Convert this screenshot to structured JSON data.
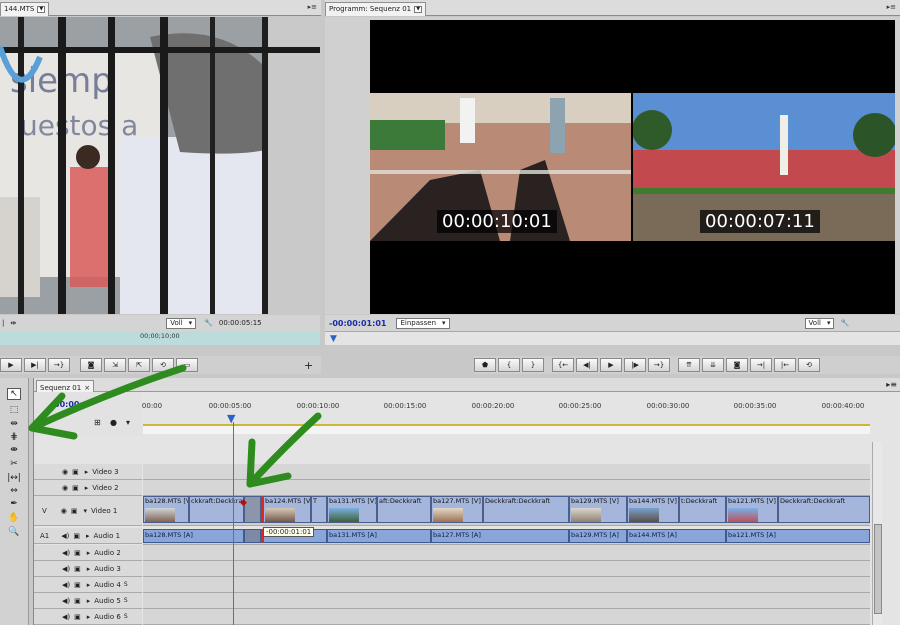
{
  "source_monitor": {
    "tab_label": "144.MTS",
    "menu": "▸≡",
    "zoom_value": "Voll",
    "timecode": "00:00:05:15",
    "mini_ruler_label": "00;00;10;00"
  },
  "program_monitor": {
    "tab_label": "Programm: Sequenz 01",
    "menu": "▸≡",
    "overlay_left_tc": "00:00:10:01",
    "overlay_right_tc": "00:00:07:11",
    "current_tc": "-00:00:01:01",
    "fit_value": "Einpassen",
    "zoom_value": "Voll"
  },
  "timeline": {
    "tab_label": "Sequenz 01",
    "playhead_tc": "00:00:0",
    "ruler": [
      "00:00",
      "00:00:05:00",
      "00:00:10:00",
      "00:00:15:00",
      "00:00:20:00",
      "00:00:25:00",
      "00:00:30:00",
      "00:00:35:00",
      "00:00:40:00"
    ],
    "tracks_video": [
      "Video 3",
      "Video 2",
      "Video 1"
    ],
    "tracks_audio": [
      "Audio 1",
      "Audio 2",
      "Audio 3",
      "Audio 4",
      "Audio 5",
      "Audio 6"
    ],
    "audio_suffix": "S",
    "v_target": "V",
    "a_target": "A1",
    "tooltip": "-00:00:01:01",
    "video_clips": [
      {
        "label": "ba128.MTS [V]"
      },
      {
        "label": "ckkraft:Deckkraft"
      },
      {
        "label": "ba124.MTS [V]"
      },
      {
        "label": "T"
      },
      {
        "label": "ba131.MTS [V]"
      },
      {
        "label": "aft:Deckkraft"
      },
      {
        "label": "ba127.MTS [V]"
      },
      {
        "label": "Deckkraft:Deckkraft"
      },
      {
        "label": "ba129.MTS [V]"
      },
      {
        "label": "ba144.MTS [V]"
      },
      {
        "label": "t:Deckkraft"
      },
      {
        "label": "ba121.MTS [V]"
      },
      {
        "label": "Deckkraft:Deckkraft"
      }
    ],
    "audio_clips": [
      {
        "label": "ba128.MTS [A]"
      },
      {
        "label": "ba131.MTS [A]"
      },
      {
        "label": "ba127.MTS [A]"
      },
      {
        "label": "ba129.MTS [A]"
      },
      {
        "label": "ba144.MTS [A]"
      },
      {
        "label": "ba121.MTS [A]"
      }
    ]
  },
  "colors": {
    "annotation_arrow": "#2e8b1e",
    "clip_video": "#a4b6dc",
    "clip_audio": "#8aa6d8",
    "playhead": "#e0452a"
  }
}
